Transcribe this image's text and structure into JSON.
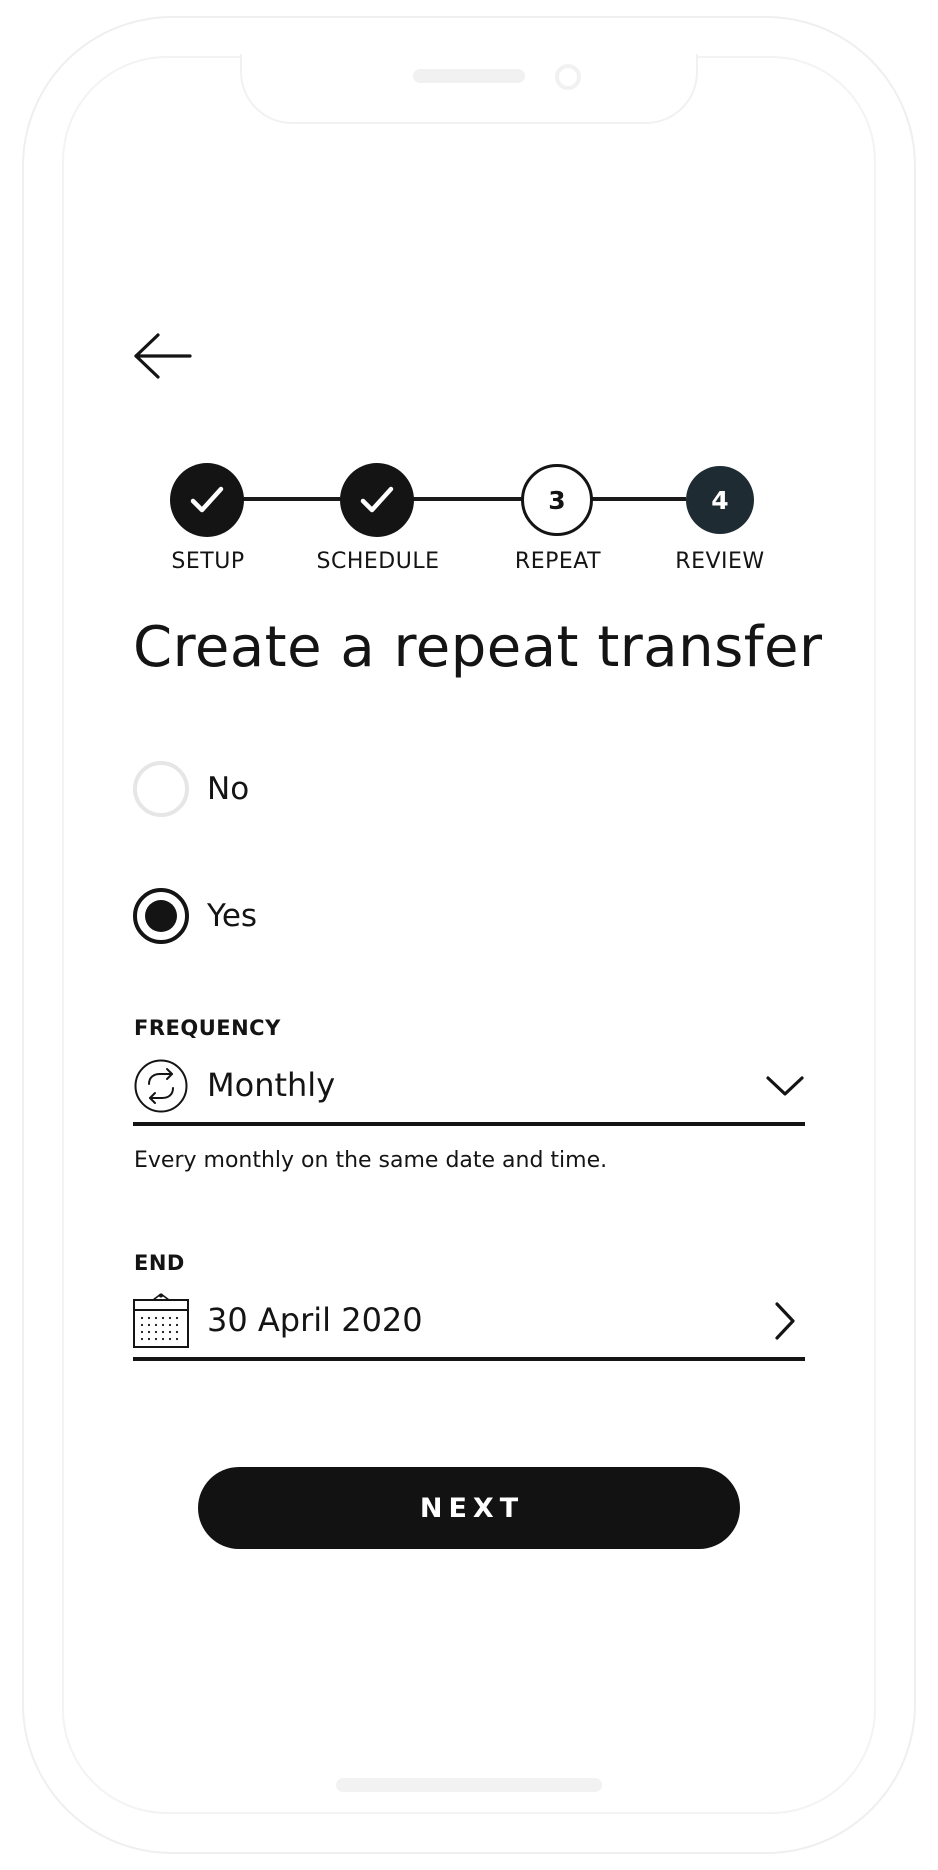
{
  "stepper": {
    "steps": [
      {
        "label": "SETUP",
        "status": "done",
        "number": ""
      },
      {
        "label": "SCHEDULE",
        "status": "done",
        "number": ""
      },
      {
        "label": "REPEAT",
        "status": "current",
        "number": "3"
      },
      {
        "label": "REVIEW",
        "status": "upcoming",
        "number": "4"
      }
    ],
    "done_icon": "check-icon"
  },
  "page": {
    "title": "Create a repeat transfer"
  },
  "repeat_options": [
    {
      "label": "No",
      "selected": false
    },
    {
      "label": "Yes",
      "selected": true
    }
  ],
  "frequency": {
    "label": "FREQUENCY",
    "value": "Monthly",
    "icon": "repeat-icon",
    "trailing_icon": "chevron-down-icon",
    "helper": "Every monthly on the same date and time."
  },
  "end": {
    "label": "END",
    "value": "30 April 2020",
    "icon": "calendar-icon",
    "trailing_icon": "chevron-right-icon"
  },
  "actions": {
    "next_label": "NEXT"
  },
  "colors": {
    "primary": "#141414",
    "active_step": "#1e2b33",
    "radio_unselected": "#e6e6e6",
    "background": "#ffffff"
  }
}
